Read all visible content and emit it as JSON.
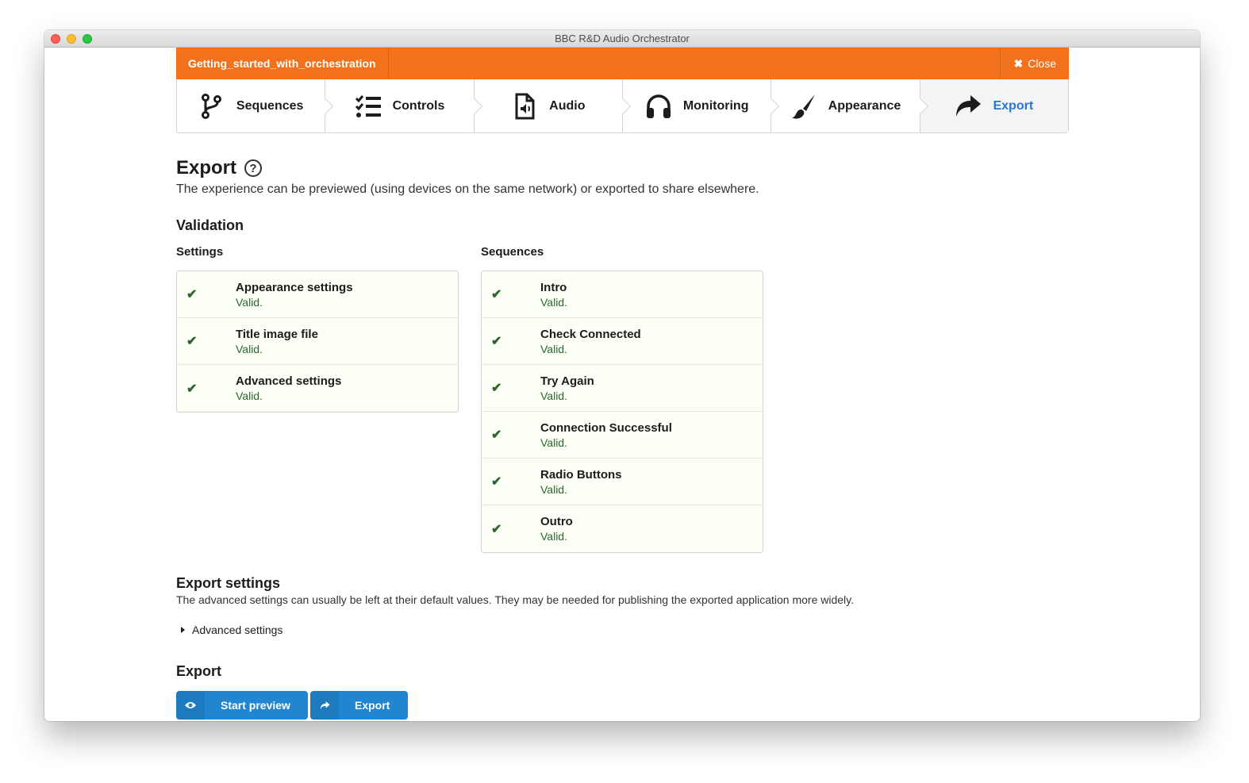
{
  "window": {
    "title": "BBC R&D Audio Orchestrator"
  },
  "header": {
    "project_name": "Getting_started_with_orchestration",
    "close_label": "Close"
  },
  "steps": [
    {
      "label": "Sequences",
      "icon": "branch-icon"
    },
    {
      "label": "Controls",
      "icon": "checklist-icon"
    },
    {
      "label": "Audio",
      "icon": "audio-file-icon"
    },
    {
      "label": "Monitoring",
      "icon": "headphones-icon"
    },
    {
      "label": "Appearance",
      "icon": "paintbrush-icon"
    },
    {
      "label": "Export",
      "icon": "share-arrow-icon",
      "active": true
    }
  ],
  "page": {
    "title": "Export",
    "help": "?",
    "subtitle": "The experience can be previewed (using devices on the same network) or exported to share elsewhere."
  },
  "validation": {
    "heading": "Validation",
    "settings": {
      "heading": "Settings",
      "items": [
        {
          "title": "Appearance settings",
          "status": "Valid."
        },
        {
          "title": "Title image file",
          "status": "Valid."
        },
        {
          "title": "Advanced settings",
          "status": "Valid."
        }
      ]
    },
    "sequences": {
      "heading": "Sequences",
      "items": [
        {
          "title": "Intro",
          "status": "Valid."
        },
        {
          "title": "Check Connected",
          "status": "Valid."
        },
        {
          "title": "Try Again",
          "status": "Valid."
        },
        {
          "title": "Connection Successful",
          "status": "Valid."
        },
        {
          "title": "Radio Buttons",
          "status": "Valid."
        },
        {
          "title": "Outro",
          "status": "Valid."
        }
      ]
    }
  },
  "export_settings": {
    "heading": "Export settings",
    "description": "The advanced settings can usually be left at their default values. They may be needed for publishing the exported application more widely.",
    "advanced_toggle": "Advanced settings"
  },
  "export": {
    "heading": "Export",
    "preview_button": "Start preview",
    "export_button": "Export"
  },
  "colors": {
    "accent_orange": "#f2711c",
    "primary_blue": "#2185d0",
    "active_step_text": "#2a77c6",
    "valid_green": "#2c662d",
    "valid_bg": "#fcfff5"
  }
}
